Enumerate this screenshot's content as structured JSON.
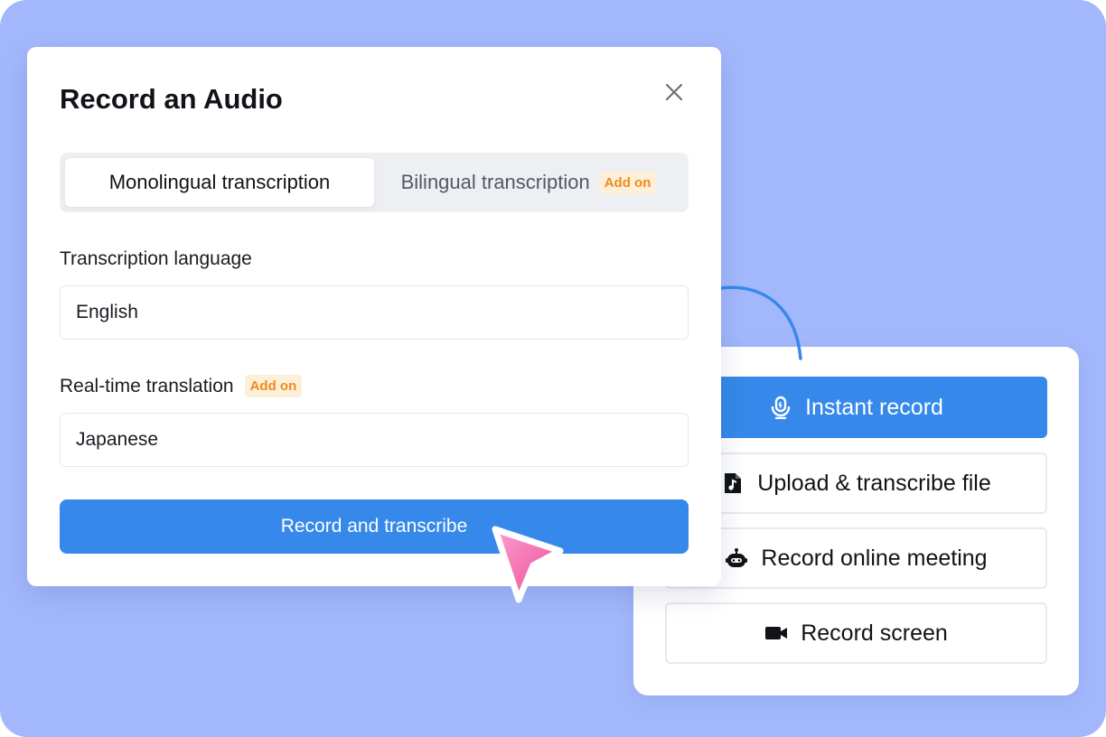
{
  "dialog": {
    "title": "Record an Audio",
    "tabs": [
      {
        "label": "Monolingual transcription",
        "active": true
      },
      {
        "label": "Bilingual transcription",
        "badge": "Add on",
        "active": false
      }
    ],
    "language_label": "Transcription language",
    "language_value": "English",
    "translation_label": "Real-time translation",
    "translation_badge": "Add on",
    "translation_value": "Japanese",
    "submit_label": "Record and transcribe"
  },
  "options": [
    {
      "label": "Instant record",
      "icon": "microphone-icon"
    },
    {
      "label": "Upload & transcribe file",
      "icon": "music-file-icon"
    },
    {
      "label": "Record online meeting",
      "icon": "bot-icon"
    },
    {
      "label": "Record screen",
      "icon": "video-camera-icon"
    }
  ],
  "colors": {
    "background": "#a3b8fc",
    "accent": "#3689ea",
    "badge_bg": "#fdf0d9",
    "badge_text": "#f08a1c",
    "cursor": "#f25fa3"
  }
}
